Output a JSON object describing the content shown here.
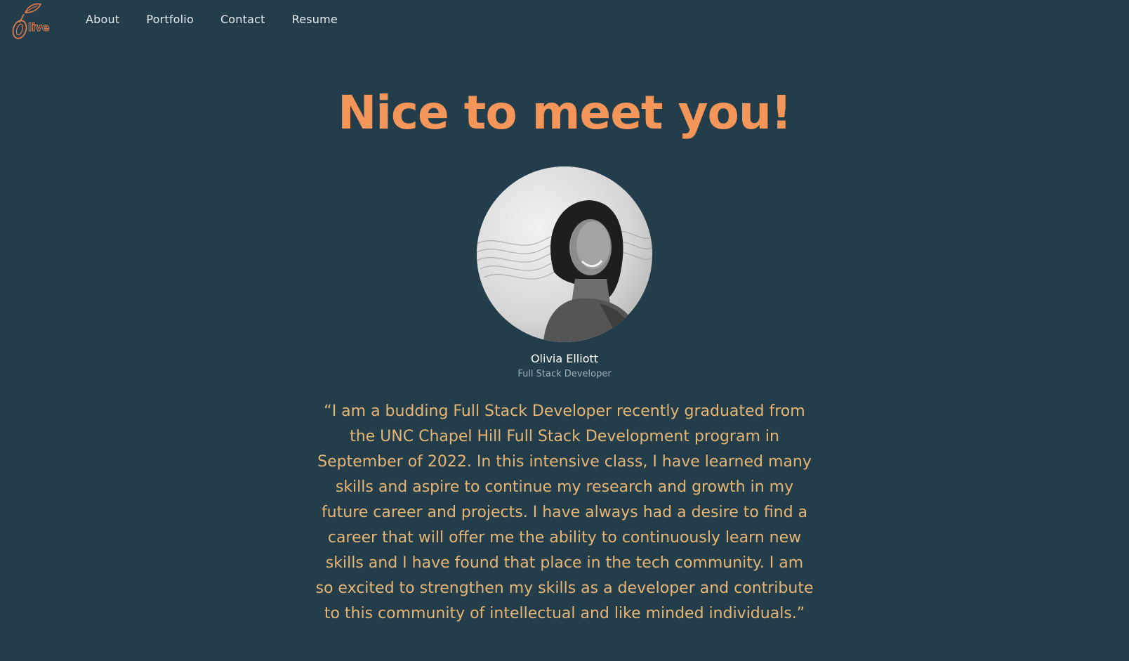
{
  "logo": {
    "text": "Olive",
    "color": "#e07c4c"
  },
  "nav": {
    "items": [
      {
        "label": "About"
      },
      {
        "label": "Portfolio"
      },
      {
        "label": "Contact"
      },
      {
        "label": "Resume"
      }
    ]
  },
  "hero": {
    "headline": "Nice to meet you!",
    "name": "Olivia Elliott",
    "role": "Full Stack Developer",
    "quote": "“I am a budding Full Stack Developer recently graduated from the UNC Chapel Hill Full Stack Development program in September of 2022. In this intensive class, I have learned many skills and aspire to continue my research and growth in my future career and projects. I have always had a desire to find a career that will offer me the ability to continuously learn new skills and I have found that place in the tech community. I am so excited to strengthen my skills as a developer and contribute to this community of intellectual and like minded individuals.”"
  },
  "colors": {
    "background": "#233d4a",
    "accent": "#f4955a",
    "quote": "#e6b574",
    "nav_text": "#e6ecef",
    "role_text": "#9fb0b8"
  }
}
